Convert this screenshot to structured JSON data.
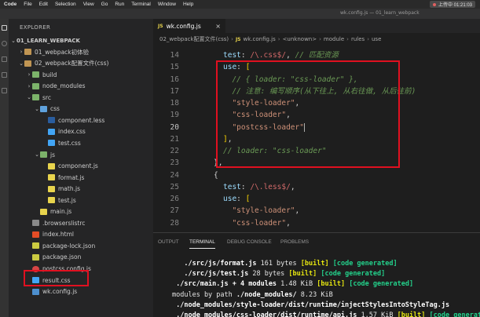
{
  "menubar": {
    "app": "Code",
    "items": [
      "File",
      "Edit",
      "Selection",
      "View",
      "Go",
      "Run",
      "Terminal",
      "Window",
      "Help"
    ],
    "recording": "上传中 01:21:03"
  },
  "window_title": "wk.config.js — 01_learn_webpack",
  "sidebar": {
    "title": "EXPLORER",
    "tree": [
      {
        "label": "01_LEARN_WEBPACK",
        "depth": 0,
        "chev": "⌄",
        "icon": "none",
        "bold": true
      },
      {
        "label": "01_webpack初体验",
        "depth": 1,
        "chev": "›",
        "icon": "folder"
      },
      {
        "label": "02_webpack配置文件(css)",
        "depth": 1,
        "chev": "⌄",
        "icon": "folder"
      },
      {
        "label": "build",
        "depth": 2,
        "chev": "›",
        "icon": "folder-green"
      },
      {
        "label": "node_modules",
        "depth": 2,
        "chev": "›",
        "icon": "folder-green"
      },
      {
        "label": "src",
        "depth": 2,
        "chev": "⌄",
        "icon": "folder-green"
      },
      {
        "label": "css",
        "depth": 3,
        "chev": "⌄",
        "icon": "folder-blue"
      },
      {
        "label": "component.less",
        "depth": 4,
        "chev": "",
        "icon": "less"
      },
      {
        "label": "index.css",
        "depth": 4,
        "chev": "",
        "icon": "css"
      },
      {
        "label": "test.css",
        "depth": 4,
        "chev": "",
        "icon": "css"
      },
      {
        "label": "js",
        "depth": 3,
        "chev": "⌄",
        "icon": "folder-green"
      },
      {
        "label": "component.js",
        "depth": 4,
        "chev": "",
        "icon": "js"
      },
      {
        "label": "format.js",
        "depth": 4,
        "chev": "",
        "icon": "js"
      },
      {
        "label": "math.js",
        "depth": 4,
        "chev": "",
        "icon": "js"
      },
      {
        "label": "test.js",
        "depth": 4,
        "chev": "",
        "icon": "js"
      },
      {
        "label": "main.js",
        "depth": 3,
        "chev": "",
        "icon": "js"
      },
      {
        "label": ".browserslistrc",
        "depth": 2,
        "chev": "",
        "icon": "txt"
      },
      {
        "label": "index.html",
        "depth": 2,
        "chev": "",
        "icon": "html"
      },
      {
        "label": "package-lock.json",
        "depth": 2,
        "chev": "",
        "icon": "json"
      },
      {
        "label": "package.json",
        "depth": 2,
        "chev": "",
        "icon": "json"
      },
      {
        "label": "postcss.config.js",
        "depth": 2,
        "chev": "",
        "icon": "cfg"
      },
      {
        "label": "result.css",
        "depth": 2,
        "chev": "",
        "icon": "css"
      },
      {
        "label": "wk.config.js",
        "depth": 2,
        "chev": "",
        "icon": "wk"
      }
    ]
  },
  "tab": {
    "badge": "JS",
    "label": "wk.config.js",
    "close": "×"
  },
  "breadcrumb": [
    "02_webpack配置文件(css)",
    "wk.config.js",
    "<unknown>",
    "module",
    "rules",
    "use"
  ],
  "editor": {
    "lines": [
      {
        "n": "14",
        "segs": [
          [
            "key",
            "test"
          ],
          [
            "punc",
            ": "
          ],
          [
            "regex",
            "/\\.css$/"
          ],
          [
            "punc",
            ", "
          ],
          [
            "comment",
            "// 匹配资源"
          ]
        ]
      },
      {
        "n": "15",
        "segs": [
          [
            "key",
            "use"
          ],
          [
            "punc",
            ": "
          ],
          [
            "brack",
            "["
          ]
        ]
      },
      {
        "n": "16",
        "segs": [
          [
            "comment",
            "  // { loader: \"css-loader\" },"
          ]
        ]
      },
      {
        "n": "17",
        "segs": [
          [
            "comment",
            "  // 注意: 编写顺序(从下往上, 从右往做, 从后往前)"
          ]
        ]
      },
      {
        "n": "18",
        "segs": [
          [
            "str",
            "  \"style-loader\""
          ],
          [
            "punc",
            ","
          ]
        ]
      },
      {
        "n": "19",
        "segs": [
          [
            "str",
            "  \"css-loader\""
          ],
          [
            "punc",
            ","
          ]
        ]
      },
      {
        "n": "20",
        "segs": [
          [
            "str",
            "  \"postcss-loader\""
          ],
          [
            "cursor",
            ""
          ]
        ],
        "active": true
      },
      {
        "n": "21",
        "segs": [
          [
            "brack",
            "]"
          ],
          [
            "punc",
            ","
          ]
        ]
      },
      {
        "n": "22",
        "segs": [
          [
            "comment",
            "// loader: \"css-loader\""
          ]
        ]
      },
      {
        "n": "23",
        "segs": [
          [
            "punc",
            "},"
          ]
        ],
        "indent": -2
      },
      {
        "n": "24",
        "segs": [
          [
            "punc",
            "{"
          ]
        ],
        "indent": -2
      },
      {
        "n": "25",
        "segs": [
          [
            "key",
            "test"
          ],
          [
            "punc",
            ": "
          ],
          [
            "regex",
            "/\\.less$/"
          ],
          [
            "punc",
            ","
          ]
        ]
      },
      {
        "n": "26",
        "segs": [
          [
            "key",
            "use"
          ],
          [
            "punc",
            ": "
          ],
          [
            "brack",
            "["
          ]
        ]
      },
      {
        "n": "27",
        "segs": [
          [
            "str",
            "  \"style-loader\""
          ],
          [
            "punc",
            ","
          ]
        ]
      },
      {
        "n": "28",
        "segs": [
          [
            "str",
            "  \"css-loader\""
          ],
          [
            "punc",
            ","
          ]
        ]
      }
    ]
  },
  "panel": {
    "tabs": [
      "OUTPUT",
      "TERMINAL",
      "DEBUG CONSOLE",
      "PROBLEMS"
    ],
    "active_tab": "TERMINAL",
    "terminal": [
      [
        [
          "w",
          "   ./src/js/format.js"
        ],
        [
          "n",
          " 161 bytes "
        ],
        [
          "y",
          "[built]"
        ],
        [
          "n",
          " "
        ],
        [
          "g",
          "[code generated]"
        ]
      ],
      [
        [
          "w",
          "   ./src/js/test.js"
        ],
        [
          "n",
          " 28 bytes "
        ],
        [
          "y",
          "[built]"
        ],
        [
          "n",
          " "
        ],
        [
          "g",
          "[code generated]"
        ]
      ],
      [
        [
          "w",
          " ./src/main.js + 4 modules"
        ],
        [
          "n",
          " 1.48 KiB "
        ],
        [
          "y",
          "[built]"
        ],
        [
          "n",
          " "
        ],
        [
          "g",
          "[code generated]"
        ]
      ],
      [
        [
          "n",
          "modules by path "
        ],
        [
          "w",
          "./node_modules/"
        ],
        [
          "n",
          " 8.23 KiB"
        ]
      ],
      [
        [
          "w",
          " ./node_modules/style-loader/dist/runtime/injectStylesIntoStyleTag.js"
        ]
      ],
      [
        [
          "w",
          " ./node_modules/css-loader/dist/runtime/api.js"
        ],
        [
          "n",
          " 1.57 KiB "
        ],
        [
          "y",
          "[built]"
        ],
        [
          "n",
          " "
        ],
        [
          "g",
          "[code generated]"
        ]
      ]
    ]
  },
  "colors": {
    "highlight_box": "#e01020",
    "editor_bg": "#1e1e1e",
    "sidebar_bg": "#252526"
  }
}
